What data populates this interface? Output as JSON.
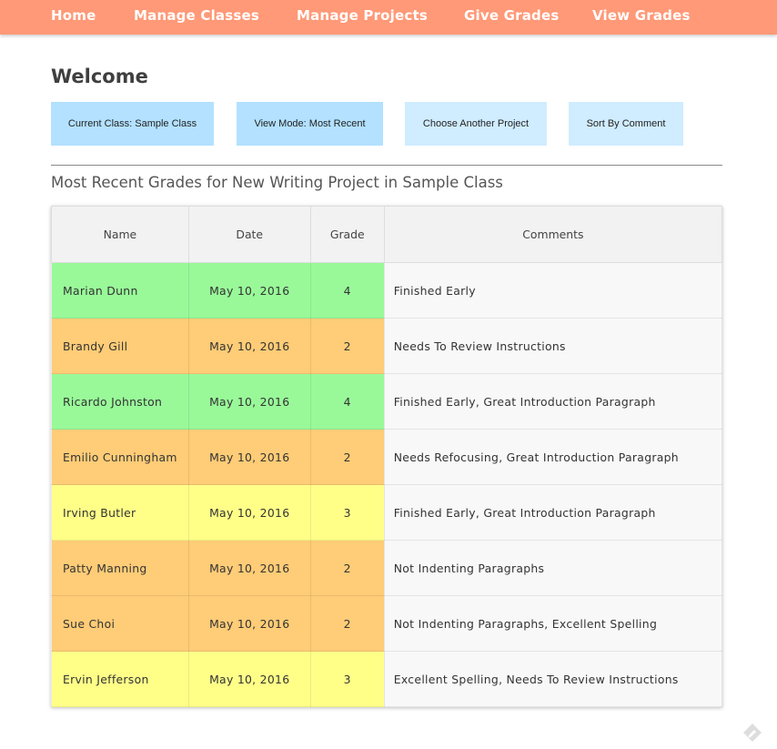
{
  "nav": {
    "items": [
      {
        "label": "Home"
      },
      {
        "label": "Manage Classes"
      },
      {
        "label": "Manage Projects"
      },
      {
        "label": "Give Grades"
      },
      {
        "label": "View Grades"
      }
    ]
  },
  "page": {
    "heading": "Welcome",
    "table_title": "Most Recent Grades for New Writing Project in Sample Class"
  },
  "controls": {
    "current_class": "Current Class: Sample Class",
    "view_mode": "View Mode: Most Recent",
    "choose_project": "Choose Another Project",
    "sort": "Sort By Comment"
  },
  "table": {
    "headers": {
      "name": "Name",
      "date": "Date",
      "grade": "Grade",
      "comments": "Comments"
    },
    "rows": [
      {
        "name": "Marian Dunn",
        "date": "May 10, 2016",
        "grade": "4",
        "comments": "Finished Early"
      },
      {
        "name": "Brandy Gill",
        "date": "May 10, 2016",
        "grade": "2",
        "comments": "Needs To Review Instructions"
      },
      {
        "name": "Ricardo Johnston",
        "date": "May 10, 2016",
        "grade": "4",
        "comments": "Finished Early, Great Introduction Paragraph"
      },
      {
        "name": "Emilio Cunningham",
        "date": "May 10, 2016",
        "grade": "2",
        "comments": "Needs Refocusing, Great Introduction Paragraph"
      },
      {
        "name": "Irving Butler",
        "date": "May 10, 2016",
        "grade": "3",
        "comments": "Finished Early, Great Introduction Paragraph"
      },
      {
        "name": "Patty Manning",
        "date": "May 10, 2016",
        "grade": "2",
        "comments": "Not Indenting Paragraphs"
      },
      {
        "name": "Sue Choi",
        "date": "May 10, 2016",
        "grade": "2",
        "comments": "Not Indenting Paragraphs, Excellent Spelling"
      },
      {
        "name": "Ervin Jefferson",
        "date": "May 10, 2016",
        "grade": "3",
        "comments": "Excellent Spelling, Needs To Review Instructions"
      }
    ]
  },
  "colors": {
    "nav_bg": "#ff9977",
    "grade_4": "#99f999",
    "grade_3": "#ffff88",
    "grade_2": "#ffcc77",
    "button_blue": "#b3e1ff",
    "button_light": "#d0ecff"
  },
  "icons": {
    "corner": "feedback-pencil-icon"
  }
}
